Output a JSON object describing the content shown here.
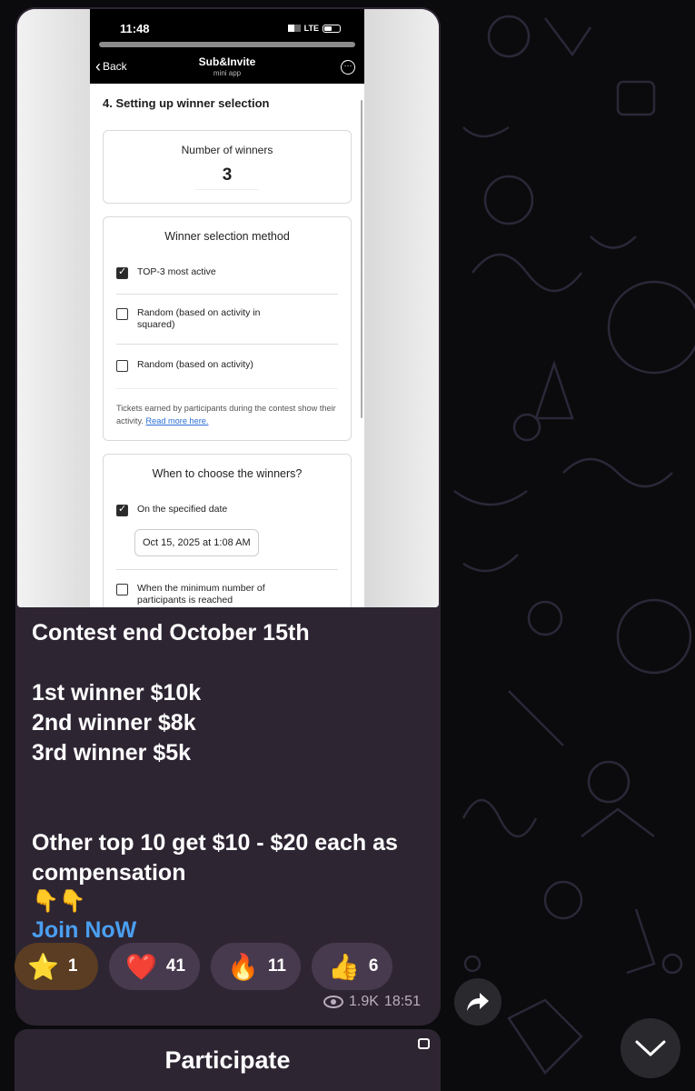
{
  "phone": {
    "time": "11:48",
    "network": "LTE",
    "back_label": "Back",
    "app_title": "Sub&Invite",
    "app_subtitle": "mini app",
    "section_title": "4. Setting up winner selection",
    "winners": {
      "label": "Number of winners",
      "value": "3"
    },
    "method": {
      "title": "Winner selection method",
      "options": [
        {
          "label": "TOP-3 most active",
          "checked": true
        },
        {
          "label": "Random (based on activity in squared)",
          "checked": false
        },
        {
          "label": "Random (based on activity)",
          "checked": false
        }
      ],
      "note": "Tickets earned by participants during the contest show their activity.",
      "note_link": "Read more here."
    },
    "when": {
      "title": "When to choose the winners?",
      "option_date": "On the specified date",
      "date_value": "Oct 15, 2025 at 1:08 AM",
      "option_min": "When the minimum number of participants is reached"
    }
  },
  "message": {
    "line1": "Contest end October 15th",
    "line2": "1st winner $10k",
    "line3": "2nd winner $8k",
    "line4": "3rd winner $5k",
    "line5": "Other top 10 get $10 - $20 each as compensation",
    "emoji": "👇👇",
    "link": "Join NoW"
  },
  "reactions": [
    {
      "emoji": "⭐",
      "count": "1"
    },
    {
      "emoji": "❤️",
      "count": "41"
    },
    {
      "emoji": "🔥",
      "count": "11"
    },
    {
      "emoji": "👍",
      "count": "6"
    }
  ],
  "meta": {
    "views": "1.9K",
    "time": "18:51"
  },
  "participate_label": "Participate",
  "colors": {
    "bubble": "#2e2533",
    "link": "#4a9ff0",
    "reaction": "#473a4e"
  }
}
